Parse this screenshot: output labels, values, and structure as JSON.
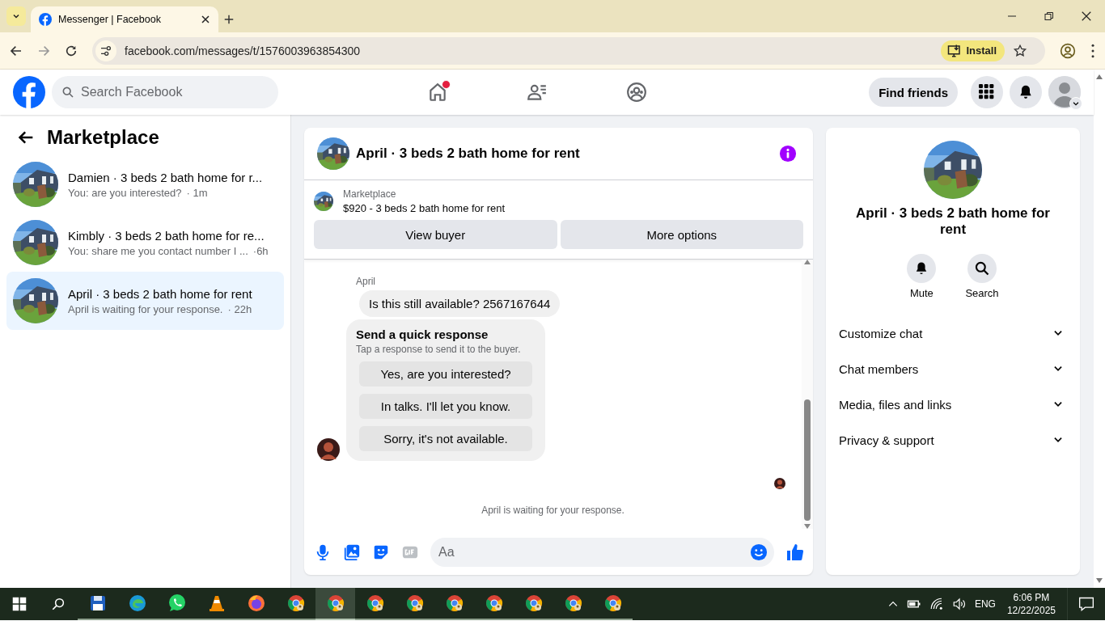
{
  "browser": {
    "tab_title": "Messenger | Facebook",
    "url": "facebook.com/messages/t/1576003963854300",
    "install": "Install"
  },
  "topbar": {
    "search_placeholder": "Search Facebook",
    "nav": [
      {
        "kind": "home",
        "notification": true
      },
      {
        "kind": "friends",
        "notification": false
      },
      {
        "kind": "groups",
        "notification": false
      }
    ],
    "find_friends": "Find friends"
  },
  "sidebar": {
    "title": "Marketplace",
    "chats": [
      {
        "title": "Damien · 3 beds 2 bath home for r...",
        "preview": "You: are you interested?",
        "time": "· 1m",
        "selected": false
      },
      {
        "title": "Kimbly · 3 beds 2 bath home for re...",
        "preview": "You: share me you contact number I ...",
        "time": "·6h",
        "selected": false
      },
      {
        "title": "April · 3 beds 2 bath home for rent",
        "preview": "April is waiting for your response.",
        "time": "· 22h",
        "selected": true
      }
    ]
  },
  "chat": {
    "title": "April · 3 beds 2 bath home for rent",
    "listing": {
      "label": "Marketplace",
      "title": "$920 - 3 beds 2 bath home for rent"
    },
    "buttons": [
      "View buyer",
      "More options"
    ],
    "sender": "April",
    "message": "Is this still available? 2567167644",
    "quick_response": {
      "title": "Send a quick response",
      "subtitle": "Tap a response to send it to the buyer.",
      "options": [
        "Yes, are you interested?",
        "In talks. I'll let you know.",
        "Sorry, it's not available."
      ]
    },
    "status": "April is waiting for your response.",
    "composer_placeholder": "Aa"
  },
  "info": {
    "title": "April · 3 beds 2 bath home for rent",
    "actions": [
      {
        "kind": "mute",
        "label": "Mute"
      },
      {
        "kind": "search",
        "label": "Search"
      }
    ],
    "sections": [
      {
        "label": "Customize chat",
        "expanded": false
      },
      {
        "label": "Chat members",
        "expanded": false
      },
      {
        "label": "Media, files and links",
        "expanded": false
      },
      {
        "label": "Privacy & support",
        "expanded": false
      }
    ]
  },
  "taskbar": {
    "apps": [
      {
        "kind": "files",
        "selected": false
      },
      {
        "kind": "edge",
        "selected": false
      },
      {
        "kind": "whatsapp",
        "selected": false
      },
      {
        "kind": "vlc",
        "selected": false
      },
      {
        "kind": "firefox",
        "selected": false
      },
      {
        "kind": "chrome",
        "selected": false
      },
      {
        "kind": "chrome",
        "selected": true
      },
      {
        "kind": "chrome",
        "selected": false
      },
      {
        "kind": "chrome",
        "selected": false
      },
      {
        "kind": "chrome",
        "selected": false
      },
      {
        "kind": "chrome",
        "selected": false
      },
      {
        "kind": "chrome",
        "selected": false
      },
      {
        "kind": "chrome",
        "selected": false
      },
      {
        "kind": "chrome",
        "selected": false
      }
    ],
    "language": "ENG",
    "time": "6:06 PM",
    "date": "12/22/2025"
  }
}
